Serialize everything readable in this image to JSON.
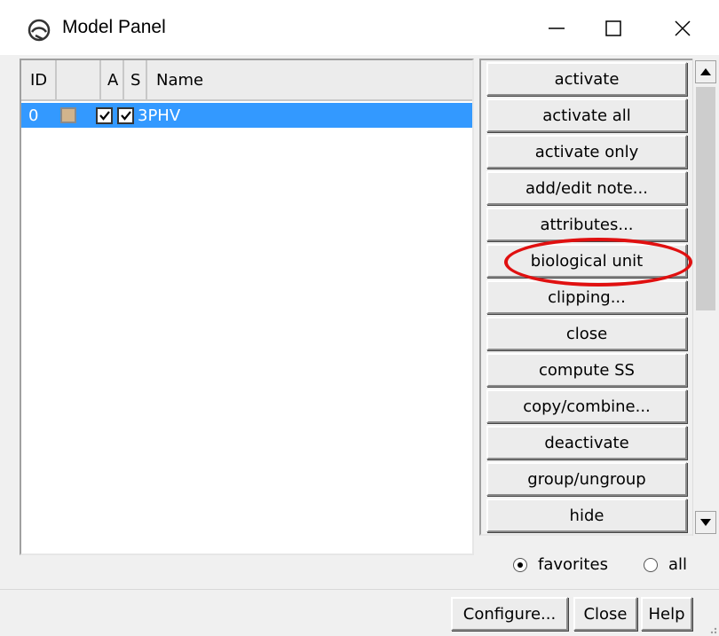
{
  "window": {
    "title": "Model Panel",
    "icon": "chimera-icon"
  },
  "table": {
    "columns": [
      "ID",
      "",
      "A",
      "S",
      "Name"
    ],
    "rows": [
      {
        "id": "0",
        "color": "#d2b48c",
        "active": true,
        "shown": true,
        "name": "3PHV"
      }
    ]
  },
  "commands": [
    "activate",
    "activate all",
    "activate only",
    "add/edit note...",
    "attributes...",
    "biological unit",
    "clipping...",
    "close",
    "compute SS",
    "copy/combine...",
    "deactivate",
    "group/ungroup",
    "hide"
  ],
  "filter": {
    "options": [
      "favorites",
      "all"
    ],
    "selected": "favorites"
  },
  "dialog_buttons": [
    "Configure...",
    "Close",
    "Help"
  ],
  "colors": {
    "selection": "#3399ff",
    "annotation_ring": "#e01010"
  }
}
